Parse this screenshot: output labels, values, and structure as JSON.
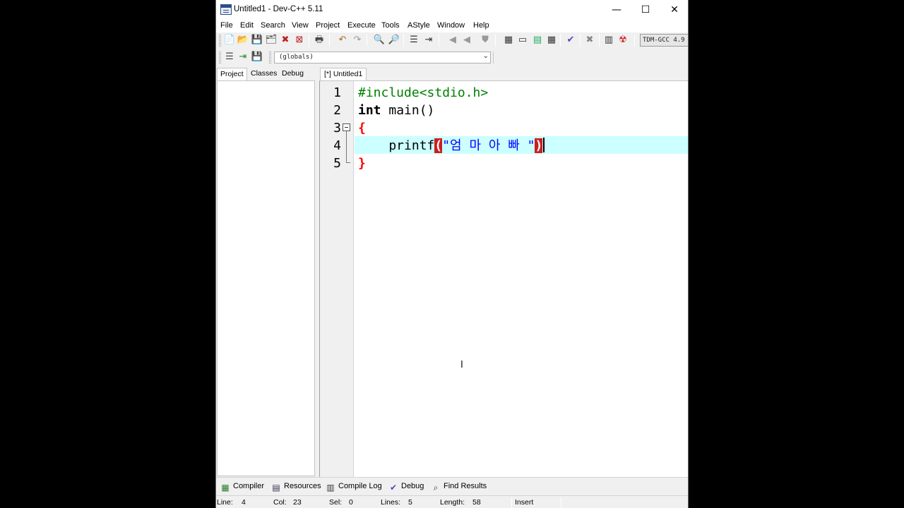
{
  "window": {
    "title": "Untitled1 - Dev-C++ 5.11"
  },
  "caption_buttons": {
    "minimize": "—",
    "maximize": "☐",
    "close": "✕"
  },
  "menu": [
    "File",
    "Edit",
    "Search",
    "View",
    "Project",
    "Execute",
    "Tools",
    "AStyle",
    "Window",
    "Help"
  ],
  "toolbar": {
    "compiler": "TDM-GCC 4.9",
    "icons": {
      "new_file": "📄",
      "open": "📂",
      "save": "💾",
      "save_all": "🗂",
      "close": "✖",
      "close_all": "⊠",
      "print": "🖶",
      "undo": "↶",
      "redo": "↷",
      "find": "🔍",
      "replace": "🔎",
      "goto": "☰",
      "indent": "⇥",
      "back": "◀",
      "forward": "◀",
      "toggle_comment": "⛊",
      "compile": "▦",
      "run": "▭",
      "compile_run": "▤",
      "rebuild": "▦",
      "check": "✔",
      "stop": "✖",
      "chart": "▥",
      "debug": "☢"
    }
  },
  "globals": {
    "value": "(globals)"
  },
  "left_tabs": [
    "Project",
    "Classes",
    "Debug"
  ],
  "editor": {
    "tab_label": "[*] Untitled1",
    "line_numbers": [
      "1",
      "2",
      "3",
      "4",
      "5"
    ],
    "lines": {
      "l1": "#include<stdio.h>",
      "l2_kw": "int",
      "l2_rest": " main()",
      "l3": "{",
      "l4_indent": "    printf",
      "l4_open": "(",
      "l4_str": "\"엄 마 아 빠 \"",
      "l4_close": ")",
      "l5": "}"
    }
  },
  "bottom_tabs": [
    {
      "label": "Compiler",
      "icon": "grid-icon"
    },
    {
      "label": "Resources",
      "icon": "resources-icon"
    },
    {
      "label": "Compile Log",
      "icon": "bar-chart-icon"
    },
    {
      "label": "Debug",
      "icon": "check-icon"
    },
    {
      "label": "Find Results",
      "icon": "find-icon"
    }
  ],
  "status": {
    "line_label": "Line:",
    "line": "4",
    "col_label": "Col:",
    "col": "23",
    "sel_label": "Sel:",
    "sel": "0",
    "lines_label": "Lines:",
    "lines": "5",
    "length_label": "Length:",
    "length": "58",
    "mode": "Insert"
  },
  "colors": {
    "current_line": "#ccffff",
    "preprocessor": "#008000",
    "string": "#0000ff",
    "bracket": "#ff0000"
  }
}
